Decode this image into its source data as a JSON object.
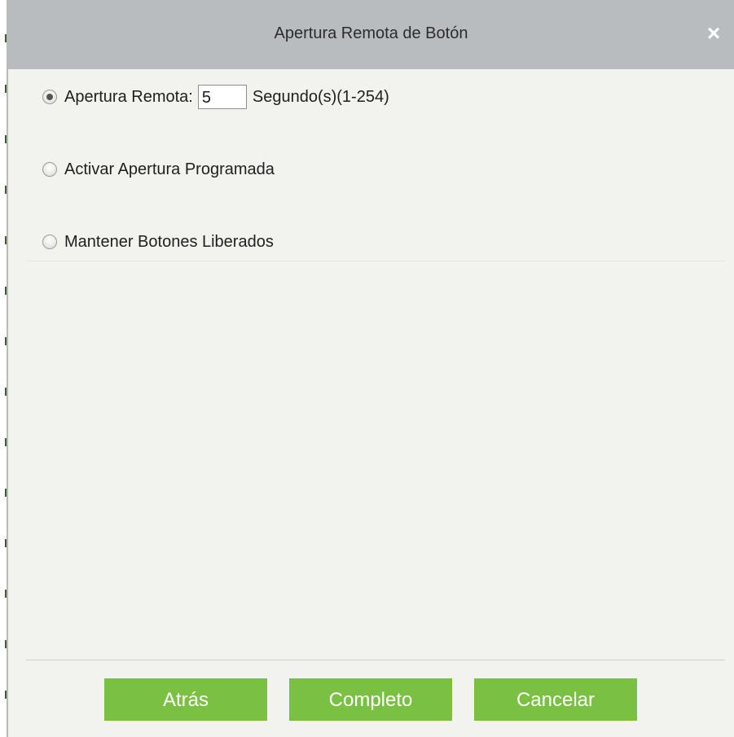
{
  "dialog": {
    "title": "Apertura Remota de Botón",
    "close_symbol": "×"
  },
  "options": {
    "remote_open": {
      "label": "Apertura Remota:",
      "selected": true,
      "value": "5",
      "unit": "Segundo(s)(1-254)"
    },
    "scheduled_open": {
      "label": "Activar Apertura Programada",
      "selected": false
    },
    "keep_released": {
      "label": "Mantener Botones Liberados",
      "selected": false
    }
  },
  "footer": {
    "back_label": "Atrás",
    "complete_label": "Completo",
    "cancel_label": "Cancelar"
  },
  "colors": {
    "title_bar": "#b9bcbf",
    "body": "#f2f3ef",
    "button": "#7ac143"
  },
  "icons": {
    "close": "close-icon",
    "radio": "radio-button"
  }
}
